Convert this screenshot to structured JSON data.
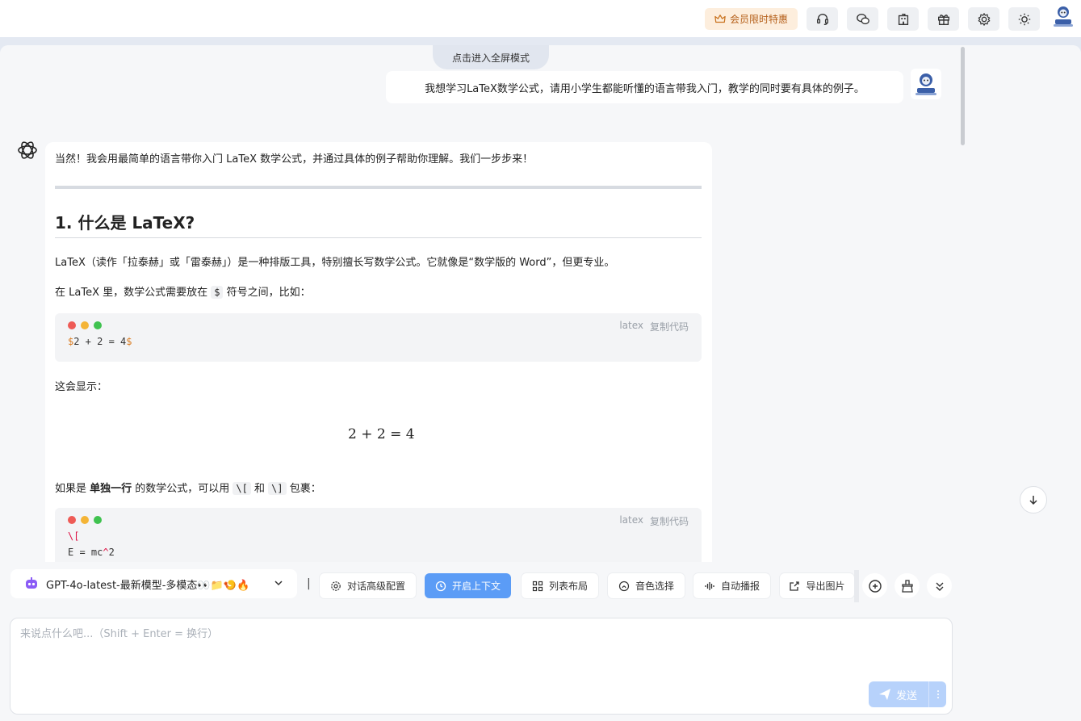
{
  "topbar": {
    "vip_label": "会员限时特惠",
    "buttons": [
      "headset-icon",
      "wechat-icon",
      "building-icon",
      "gift-icon",
      "gear-icon",
      "sun-icon"
    ]
  },
  "fullscreen_label": "点击进入全屏模式",
  "user_message": "我想学习LaTeX数学公式，请用小学生都能听懂的语言带我入门，教学的同时要有具体的例子。",
  "answer": {
    "intro": "当然！我会用最简单的语言带你入门 LaTeX 数学公式，并通过具体的例子帮助你理解。我们一步步来！",
    "heading": "1. 什么是 LaTeX?",
    "para1": "LaTeX（读作「拉泰赫」或「雷泰赫」）是一种排版工具，特别擅长写数学公式。它就像是“数学版的 Word”，但更专业。",
    "para2_before": "在 LaTeX 里，数学公式需要放在 ",
    "para2_code": "$",
    "para2_after": " 符号之间，比如：",
    "code1": {
      "lang": "latex",
      "copy": "复制代码",
      "delim": "$",
      "body": "2 + 2 = 4"
    },
    "para3": "这会显示：",
    "math_display": "2 + 2 = 4",
    "para4_a": "如果是 ",
    "para4_bold": "单独一行",
    "para4_b": " 的数学公式，可以用 ",
    "para4_code1": "\\[",
    "para4_c": " 和 ",
    "para4_code2": "\\]",
    "para4_d": " 包裹：",
    "code2": {
      "lang": "latex",
      "copy": "复制代码",
      "line1": "\\[",
      "line2_a": "E = mc",
      "line2_op": "^",
      "line2_b": "2"
    }
  },
  "toolbar": {
    "model": "GPT-4o-latest-最新模型-多模态👀📁🍤🔥",
    "separator": "|",
    "buttons": {
      "advanced": "对话高级配置",
      "context": "开启上下文",
      "layout": "列表布局",
      "voice": "音色选择",
      "autoplay": "自动播报",
      "export": "导出图片"
    }
  },
  "input": {
    "placeholder": "来说点什么吧...（Shift + Enter = 换行）",
    "send_label": "发送"
  },
  "colors": {
    "accent": "#5b9cf6",
    "vip_bg": "#fdeedd",
    "vip_text": "#b5601a"
  }
}
